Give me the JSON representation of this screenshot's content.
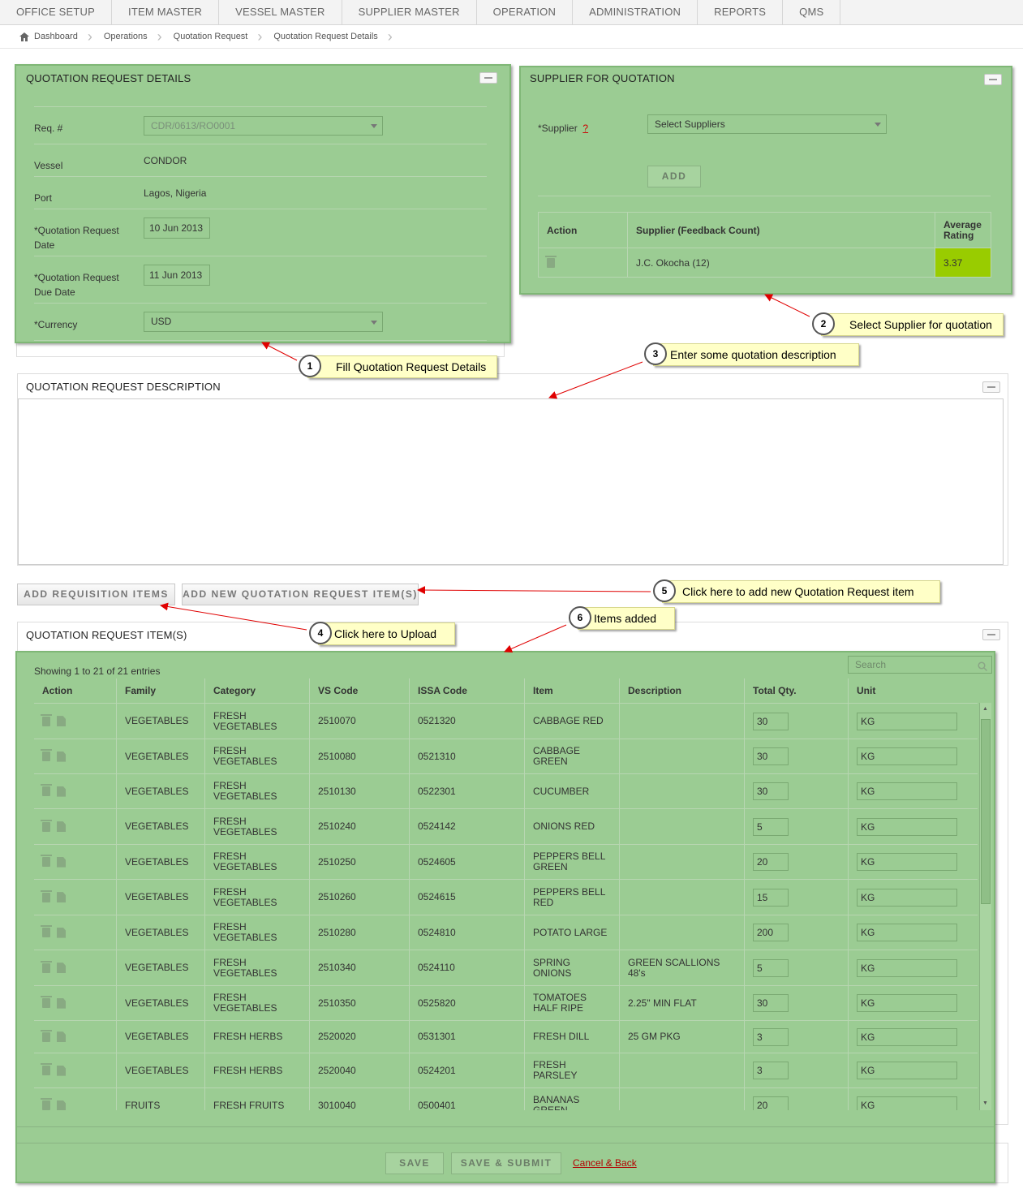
{
  "nav": [
    "OFFICE SETUP",
    "ITEM MASTER",
    "VESSEL MASTER",
    "SUPPLIER MASTER",
    "OPERATION",
    "ADMINISTRATION",
    "REPORTS",
    "QMS"
  ],
  "breadcrumb": [
    "Dashboard",
    "Operations",
    "Quotation Request",
    "Quotation Request Details"
  ],
  "details": {
    "title": "QUOTATION REQUEST DETAILS",
    "req_label": "Req. #",
    "req_value": "CDR/0613/RO0001",
    "vessel_label": "Vessel",
    "vessel_value": "CONDOR",
    "port_label": "Port",
    "port_value": "Lagos, Nigeria",
    "qr_date_label1": "*Quotation Request",
    "qr_date_label2": "Date",
    "qr_date_value": "10 Jun 2013",
    "due_date_label1": "*Quotation Request",
    "due_date_label2": "Due Date",
    "due_date_value": "11 Jun 2013",
    "currency_label": "*Currency",
    "currency_value": "USD"
  },
  "supplier": {
    "title": "SUPPLIER FOR QUOTATION",
    "label": "*Supplier",
    "help": "?",
    "select_placeholder": "Select Suppliers",
    "add_label": "ADD",
    "col_action": "Action",
    "col_supplier": "Supplier (Feedback Count)",
    "col_rating1": "Average",
    "col_rating2": "Rating",
    "row_supplier": "J.C. Okocha (12)",
    "row_rating": "3.37"
  },
  "description": {
    "title": "QUOTATION REQUEST DESCRIPTION"
  },
  "buttons": {
    "add_requisition": "ADD REQUISITION ITEMS",
    "add_new_item": "ADD NEW QUOTATION REQUEST ITEM(S)",
    "save": "SAVE",
    "save_submit": "SAVE & SUBMIT",
    "cancel": "Cancel & Back"
  },
  "items": {
    "title": "QUOTATION REQUEST ITEM(S)",
    "showing": "Showing 1 to 21 of 21 entries",
    "search_placeholder": "Search",
    "columns": [
      "Action",
      "Family",
      "Category",
      "VS Code",
      "ISSA Code",
      "Item",
      "Description",
      "Total Qty.",
      "Unit"
    ],
    "rows": [
      {
        "family": "VEGETABLES",
        "category": "FRESH VEGETABLES",
        "vs": "2510070",
        "issa": "0521320",
        "item": "CABBAGE RED",
        "desc": "",
        "qty": "30",
        "unit": "KG"
      },
      {
        "family": "VEGETABLES",
        "category": "FRESH VEGETABLES",
        "vs": "2510080",
        "issa": "0521310",
        "item": "CABBAGE GREEN",
        "desc": "",
        "qty": "30",
        "unit": "KG"
      },
      {
        "family": "VEGETABLES",
        "category": "FRESH VEGETABLES",
        "vs": "2510130",
        "issa": "0522301",
        "item": "CUCUMBER",
        "desc": "",
        "qty": "30",
        "unit": "KG"
      },
      {
        "family": "VEGETABLES",
        "category": "FRESH VEGETABLES",
        "vs": "2510240",
        "issa": "0524142",
        "item": "ONIONS RED",
        "desc": "",
        "qty": "5",
        "unit": "KG"
      },
      {
        "family": "VEGETABLES",
        "category": "FRESH VEGETABLES",
        "vs": "2510250",
        "issa": "0524605",
        "item": "PEPPERS BELL GREEN",
        "desc": "",
        "qty": "20",
        "unit": "KG"
      },
      {
        "family": "VEGETABLES",
        "category": "FRESH VEGETABLES",
        "vs": "2510260",
        "issa": "0524615",
        "item": "PEPPERS BELL RED",
        "desc": "",
        "qty": "15",
        "unit": "KG"
      },
      {
        "family": "VEGETABLES",
        "category": "FRESH VEGETABLES",
        "vs": "2510280",
        "issa": "0524810",
        "item": "POTATO LARGE",
        "desc": "",
        "qty": "200",
        "unit": "KG"
      },
      {
        "family": "VEGETABLES",
        "category": "FRESH VEGETABLES",
        "vs": "2510340",
        "issa": "0524110",
        "item": "SPRING ONIONS",
        "desc": "GREEN SCALLIONS 48's",
        "qty": "5",
        "unit": "KG"
      },
      {
        "family": "VEGETABLES",
        "category": "FRESH VEGETABLES",
        "vs": "2510350",
        "issa": "0525820",
        "item": "TOMATOES HALF RIPE",
        "desc": "2.25\" MIN FLAT",
        "qty": "30",
        "unit": "KG"
      },
      {
        "family": "VEGETABLES",
        "category": "FRESH HERBS",
        "vs": "2520020",
        "issa": "0531301",
        "item": "FRESH DILL",
        "desc": "25 GM PKG",
        "qty": "3",
        "unit": "KG"
      },
      {
        "family": "VEGETABLES",
        "category": "FRESH HERBS",
        "vs": "2520040",
        "issa": "0524201",
        "item": "FRESH PARSLEY",
        "desc": "",
        "qty": "3",
        "unit": "KG"
      },
      {
        "family": "FRUITS",
        "category": "FRESH FRUITS",
        "vs": "3010040",
        "issa": "0500401",
        "item": "BANANAS GREEN",
        "desc": "",
        "qty": "20",
        "unit": "KG"
      }
    ]
  },
  "callouts": [
    {
      "num": "1",
      "text": "Fill Quotation Request Details"
    },
    {
      "num": "2",
      "text": "Select Supplier for quotation"
    },
    {
      "num": "3",
      "text": "Enter some quotation description"
    },
    {
      "num": "4",
      "text": "Click here to Upload"
    },
    {
      "num": "5",
      "text": "Click here to add new Quotation Request item"
    },
    {
      "num": "6",
      "text": "Items added"
    }
  ],
  "colors": {
    "highlight_green": "#9bcc93",
    "rating_green": "#99cc00",
    "callout_yellow": "#ffffc7",
    "arrow_red": "#e00000"
  }
}
